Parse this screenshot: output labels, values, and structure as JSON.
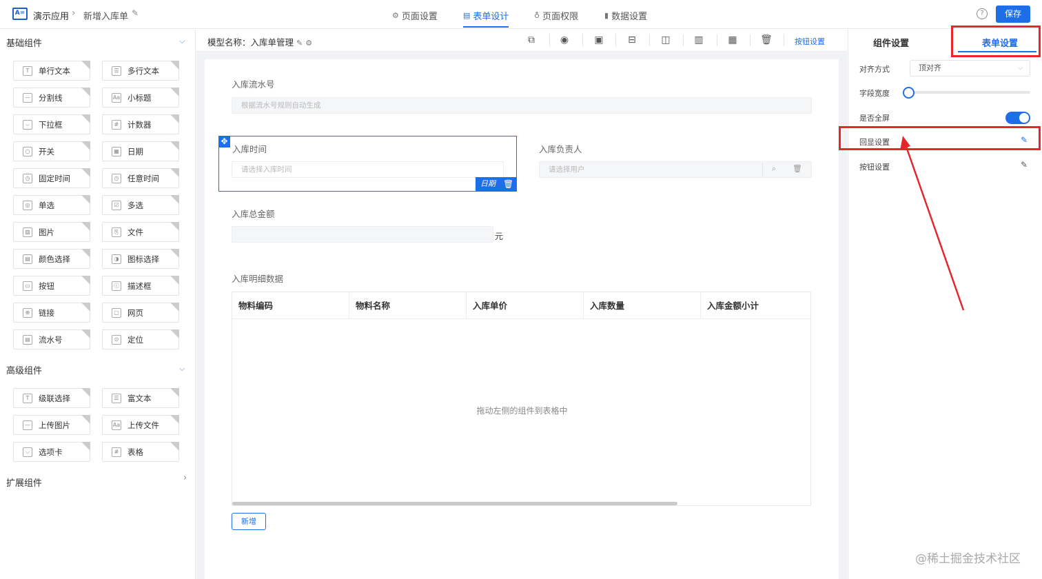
{
  "app": {
    "name": "演示应用",
    "breadcrumb_sep": "›",
    "page_name": "新增入库单",
    "save_label": "保存",
    "help_glyph": "?"
  },
  "top_tabs": [
    {
      "label": "页面设置",
      "icon": "gear-icon",
      "active": false
    },
    {
      "label": "表单设计",
      "icon": "document-icon",
      "active": true
    },
    {
      "label": "页面权限",
      "icon": "lock-icon",
      "active": false
    },
    {
      "label": "数据设置",
      "icon": "bar-chart-icon",
      "active": false
    }
  ],
  "left": {
    "basic_title": "基础组件",
    "basic_components": [
      "单行文本",
      "多行文本",
      "分割线",
      "小标题",
      "下拉框",
      "计数器",
      "开关",
      "日期",
      "固定时间",
      "任意时间",
      "单选",
      "多选",
      "图片",
      "文件",
      "颜色选择",
      "图标选择",
      "按钮",
      "描述框",
      "链接",
      "网页",
      "流水号",
      "定位"
    ],
    "advanced_title": "高级组件",
    "advanced_components": [
      "级联选择",
      "富文本",
      "上传图片",
      "上传文件",
      "选项卡",
      "表格"
    ],
    "extension_title": "扩展组件"
  },
  "center": {
    "model_label": "模型名称：入库单管理",
    "button_settings_link": "按钮设置",
    "toolbar_icons": [
      "link-icon",
      "eye-icon",
      "layout-1-icon",
      "layout-row-icon",
      "layout-2col-icon",
      "layout-3col-icon",
      "layout-4col-icon",
      "trash-icon"
    ]
  },
  "form": {
    "serial_label": "入库流水号",
    "serial_placeholder": "根据流水号规则自动生成",
    "time_label": "入库时间",
    "time_placeholder": "请选择入库时间",
    "time_type_tag": "日期",
    "owner_label": "入库负责人",
    "owner_placeholder": "请选择用户",
    "amount_label": "入库总金额",
    "amount_unit": "元",
    "detail_label": "入库明细数据",
    "table_columns": [
      "物料编码",
      "物料名称",
      "入库单价",
      "入库数量",
      "入库金额小计"
    ],
    "table_empty_hint": "拖动左侧的组件到表格中",
    "add_button": "新增"
  },
  "right": {
    "tab_component": "组件设置",
    "tab_form": "表单设置",
    "align_label": "对齐方式",
    "align_value": "顶对齐",
    "field_width_label": "字段宽度",
    "field_width_value": 0,
    "fullscreen_label": "是否全屏",
    "fullscreen_on": true,
    "echo_label": "回显设置",
    "button_label": "按钮设置"
  },
  "watermark": "@稀土掘金技术社区",
  "colors": {
    "accent": "#1e6ee8",
    "annotation": "#e5262b"
  }
}
